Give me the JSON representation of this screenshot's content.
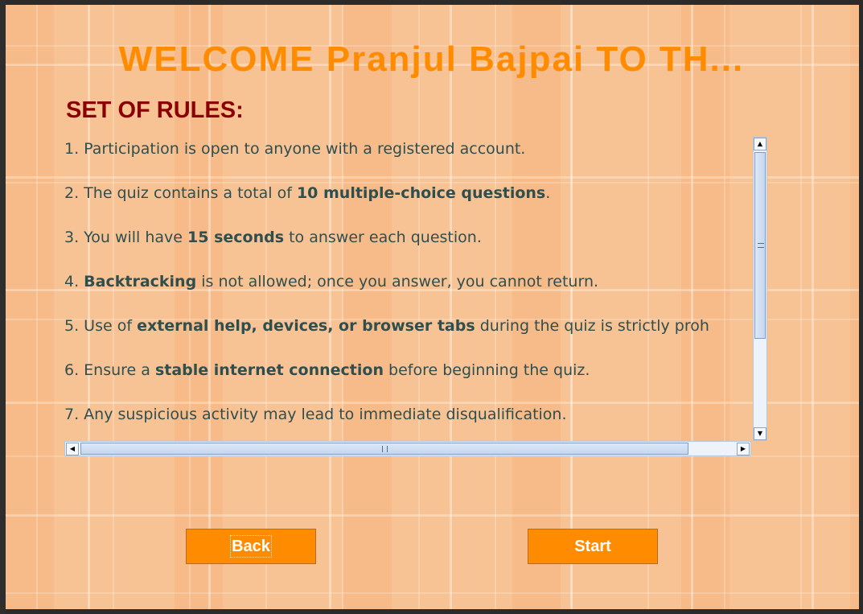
{
  "welcome_title": "WELCOME Pranjul Bajpai TO TH...",
  "rules_heading": "SET OF RULES:",
  "rules": [
    {
      "num": "1. ",
      "pre": "Participation is open to anyone with a registered account.",
      "bold": "",
      "post": ""
    },
    {
      "num": "2. ",
      "pre": "The quiz contains a total of ",
      "bold": "10 multiple-choice questions",
      "post": "."
    },
    {
      "num": "3. ",
      "pre": "You will have ",
      "bold": "15 seconds",
      "post": " to answer each question."
    },
    {
      "num": "4. ",
      "pre": "",
      "bold": "Backtracking",
      "post": " is not allowed; once you answer, you cannot return."
    },
    {
      "num": "5. ",
      "pre": "Use of ",
      "bold": "external help, devices, or browser tabs",
      "post": " during the quiz is strictly proh"
    },
    {
      "num": "6. ",
      "pre": "Ensure a ",
      "bold": "stable internet connection",
      "post": " before beginning the quiz."
    },
    {
      "num": "7. ",
      "pre": "Any suspicious activity may lead to immediate disqualification.",
      "bold": "",
      "post": ""
    }
  ],
  "buttons": {
    "back_label": "Back",
    "start_label": "Start"
  },
  "colors": {
    "title": "#ff8c00",
    "heading": "#8b0000",
    "rule_text": "#2f4f4f",
    "button_bg": "#ff8c00",
    "button_text": "#ffffff",
    "background": "#f8c394"
  },
  "icons": {
    "scroll_up": "triangle-up-icon",
    "scroll_down": "triangle-down-icon",
    "scroll_left": "triangle-left-icon",
    "scroll_right": "triangle-right-icon"
  }
}
